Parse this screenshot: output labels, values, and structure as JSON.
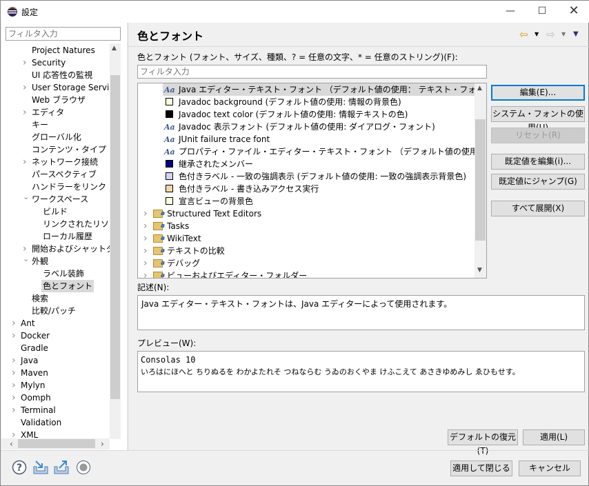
{
  "window": {
    "title": "設定",
    "icon": "eclipse-icon"
  },
  "left": {
    "filter_placeholder": "フィルタ入力",
    "items": [
      {
        "label": "Project Natures",
        "level": 1,
        "arrow": ""
      },
      {
        "label": "Security",
        "level": 1,
        "arrow": "collapsed"
      },
      {
        "label": "UI 応答性の監視",
        "level": 1,
        "arrow": ""
      },
      {
        "label": "User Storage Service",
        "level": 1,
        "arrow": "collapsed"
      },
      {
        "label": "Web ブラウザ",
        "level": 1,
        "arrow": ""
      },
      {
        "label": "エディタ",
        "level": 1,
        "arrow": "collapsed"
      },
      {
        "label": "キー",
        "level": 1,
        "arrow": ""
      },
      {
        "label": "グローバル化",
        "level": 1,
        "arrow": ""
      },
      {
        "label": "コンテンツ・タイプ",
        "level": 1,
        "arrow": ""
      },
      {
        "label": "ネットワーク接続",
        "level": 1,
        "arrow": "collapsed"
      },
      {
        "label": "パースペクティブ",
        "level": 1,
        "arrow": ""
      },
      {
        "label": "ハンドラーをリンク",
        "level": 1,
        "arrow": ""
      },
      {
        "label": "ワークスペース",
        "level": 1,
        "arrow": "expanded"
      },
      {
        "label": "ビルド",
        "level": 2,
        "arrow": ""
      },
      {
        "label": "リンクされたリソース",
        "level": 2,
        "arrow": ""
      },
      {
        "label": "ローカル履歴",
        "level": 2,
        "arrow": ""
      },
      {
        "label": "開始およびシャットダウン",
        "level": 1,
        "arrow": "collapsed"
      },
      {
        "label": "外観",
        "level": 1,
        "arrow": "expanded"
      },
      {
        "label": "ラベル装飾",
        "level": 2,
        "arrow": ""
      },
      {
        "label": "色とフォント",
        "level": 2,
        "arrow": "",
        "selected": true
      },
      {
        "label": "検索",
        "level": 1,
        "arrow": ""
      },
      {
        "label": "比較/パッチ",
        "level": 1,
        "arrow": ""
      },
      {
        "label": "Ant",
        "level": 0,
        "arrow": "collapsed"
      },
      {
        "label": "Docker",
        "level": 0,
        "arrow": "collapsed"
      },
      {
        "label": "Gradle",
        "level": 0,
        "arrow": ""
      },
      {
        "label": "Java",
        "level": 0,
        "arrow": "collapsed"
      },
      {
        "label": "Maven",
        "level": 0,
        "arrow": "collapsed"
      },
      {
        "label": "Mylyn",
        "level": 0,
        "arrow": "collapsed"
      },
      {
        "label": "Oomph",
        "level": 0,
        "arrow": "collapsed"
      },
      {
        "label": "Terminal",
        "level": 0,
        "arrow": "collapsed"
      },
      {
        "label": "Validation",
        "level": 0,
        "arrow": ""
      },
      {
        "label": "XML",
        "level": 0,
        "arrow": "collapsed"
      }
    ]
  },
  "main": {
    "title": "色とフォント",
    "nav": {
      "back": "back-arrow-icon",
      "forward": "forward-arrow-icon",
      "menu": "view-menu-icon"
    },
    "colors_label": "色とフォント (フォント、サイズ、種類、? = 任意の文字、* = 任意のストリング)(F):",
    "filter_placeholder": "フィルタ入力",
    "tree": [
      {
        "type": "font",
        "label": "Java エディター・テキスト・フォント （デフォルト値の使用： テキスト・フォント）",
        "selected": true
      },
      {
        "type": "color",
        "color": "#ffffe1",
        "label": "Javadoc background (デフォルト値の使用: 情報の背景色)"
      },
      {
        "type": "color",
        "color": "#000000",
        "label": "Javadoc text color (デフォルト値の使用: 情報テキストの色)"
      },
      {
        "type": "font",
        "label": "Javadoc 表示フォント (デフォルト値の使用: ダイアログ・フォント)"
      },
      {
        "type": "font",
        "label": "JUnit failure trace font"
      },
      {
        "type": "font",
        "label": "プロパティ・ファイル・エディター・テキスト・フォント （デフォルト値の使用： テキスト・フォント）"
      },
      {
        "type": "color",
        "color": "#000080",
        "label": "継承されたメンバー"
      },
      {
        "type": "color",
        "color": "#d4d4f7",
        "label": "色付きラベル - 一致の強調表示 (デフォルト値の使用: 一致の強調表示背景色)"
      },
      {
        "type": "color",
        "color": "#f0d8a8",
        "label": "色付きラベル - 書き込みアクセス実行"
      },
      {
        "type": "color",
        "color": "#ffffe1",
        "label": "宣言ビューの背景色"
      },
      {
        "type": "folder",
        "label": "Structured Text Editors"
      },
      {
        "type": "folder",
        "label": "Tasks"
      },
      {
        "type": "folder",
        "label": "WikiText"
      },
      {
        "type": "folder",
        "label": "テキストの比較"
      },
      {
        "type": "folder",
        "label": "デバッグ"
      },
      {
        "type": "folder",
        "label": "ビューおよびエディター・フォルダー"
      }
    ],
    "buttons": {
      "edit": "編集(E)...",
      "system_font": "システム・フォントの使用(U)",
      "reset": "リセット(R)",
      "edit_default": "既定値を編集(i)...",
      "goto_default": "既定値にジャンプ(G)",
      "expand_all": "すべて展開(X)"
    },
    "description_label": "記述(N):",
    "description": "Java エディター・テキスト・フォントは、Java エディターによって使用されます。",
    "preview_label": "プレビュー(W):",
    "preview_font": "Consolas 10",
    "preview_text": "いろはにほへと ちりぬるを わかよたれそ つねならむ うゐのおくやま けふこえて あさきゆめみし ゑひもせす。",
    "restore_defaults": "デフォルトの復元(T)",
    "apply": "適用(L)"
  },
  "footer": {
    "apply_close": "適用して閉じる",
    "cancel": "キャンセル",
    "icons": [
      "help-icon",
      "import-icon",
      "export-icon",
      "record-icon"
    ]
  }
}
